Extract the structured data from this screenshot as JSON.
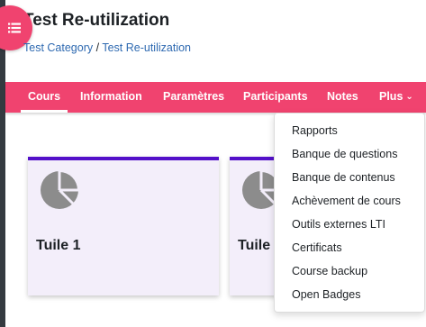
{
  "header": {
    "title": "Test Re-utilization",
    "drawer_icon": "list-icon",
    "breadcrumb": {
      "category": "Test Category",
      "separator": "/",
      "course": "Test Re-utilization"
    }
  },
  "nav": {
    "tabs": [
      {
        "label": "Cours",
        "active": true
      },
      {
        "label": "Information"
      },
      {
        "label": "Paramètres"
      },
      {
        "label": "Participants"
      },
      {
        "label": "Notes"
      },
      {
        "label": "Plus",
        "chevron": "⌄"
      }
    ]
  },
  "dropdown": {
    "items": [
      "Rapports",
      "Banque de questions",
      "Banque de contenus",
      "Achèvement de cours",
      "Outils externes LTI",
      "Certificats",
      "Course backup",
      "Open Badges"
    ]
  },
  "tiles": [
    {
      "title": "Tuile 1",
      "icon": "pie-chart-icon"
    },
    {
      "title": "Tuile",
      "icon": "pie-chart-icon"
    }
  ],
  "colors": {
    "brand": "#f0436f",
    "tile_accent": "#5310c9",
    "tile_bg": "#f3eefa",
    "link": "#2f6ab1"
  }
}
